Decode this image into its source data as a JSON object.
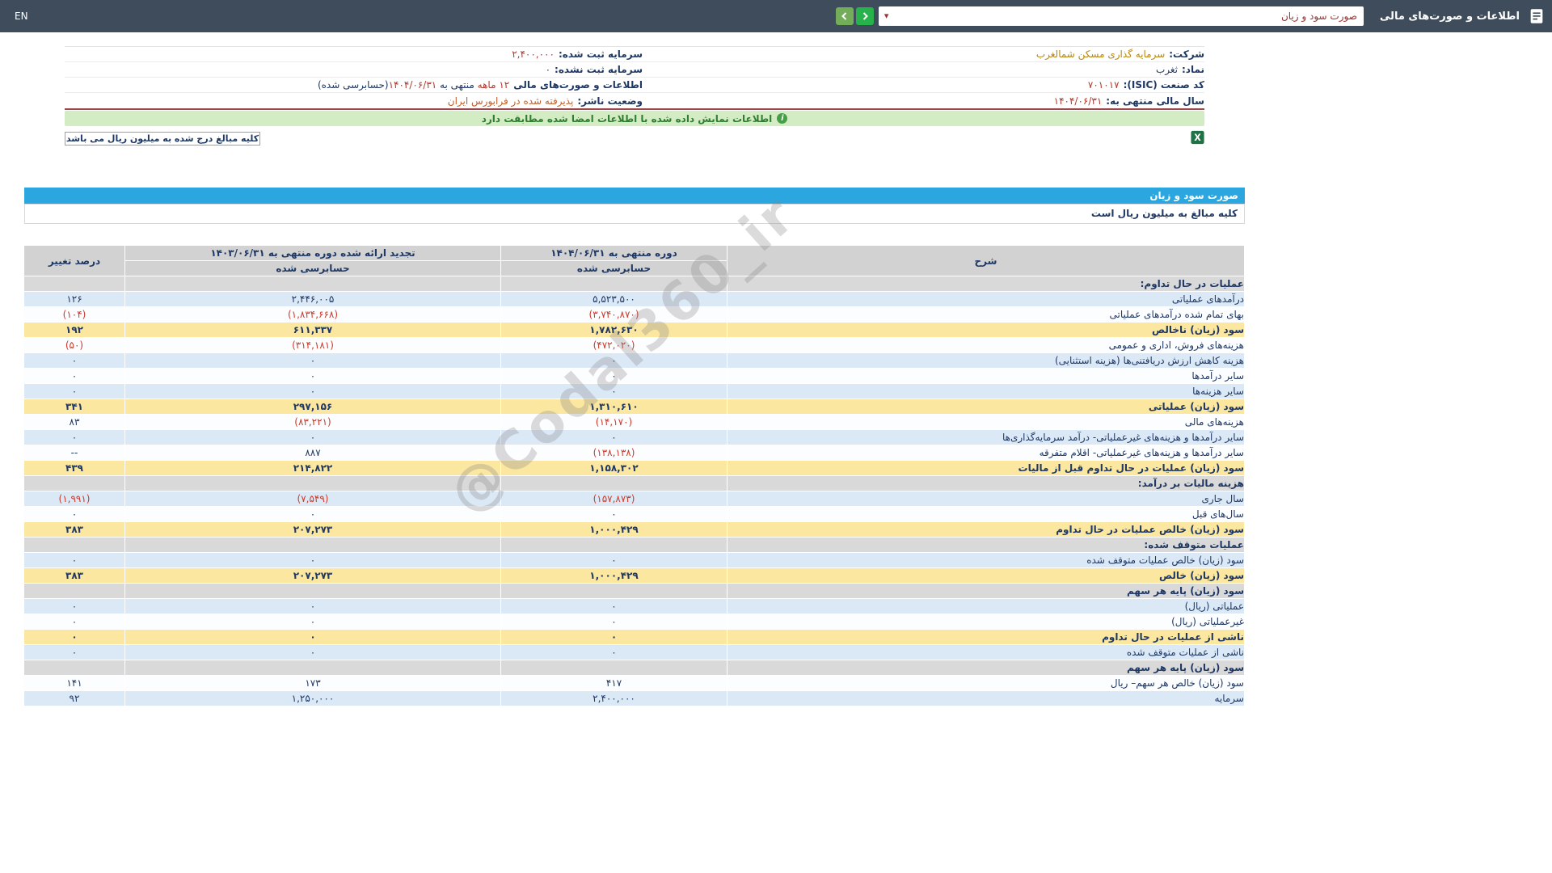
{
  "topbar": {
    "en_label": "EN",
    "title": "اطلاعات و صورت‌های مالی",
    "report_select_value": "صورت سود و زیان"
  },
  "banner": {
    "text": "اطلاعات نمایش داده شده با اطلاعات امضا شده مطابقت دارد",
    "icon": "i"
  },
  "note": {
    "text": "کلیه مبالغ درج شده به میلیون ریال می باشد"
  },
  "company_info": {
    "rows": [
      {
        "right": {
          "label": "شرکت:",
          "value": "سرمایه گذاری مسکن شمالغرب",
          "style": "company"
        },
        "left": {
          "label": "سرمایه ثبت شده:",
          "value": "۲,۴۰۰,۰۰۰",
          "style": "red"
        }
      },
      {
        "right": {
          "label": "نماد:",
          "value": "ثغرب",
          "style": "navy"
        },
        "left": {
          "label": "سرمایه ثبت نشده:",
          "value": "۰",
          "style": "navy"
        }
      },
      {
        "right": {
          "label": "کد صنعت (ISIC):",
          "value": "۷۰۱۰۱۷",
          "style": "red"
        },
        "left": {
          "label": "اطلاعات و صورت‌های مالی",
          "parts": [
            {
              "t": "۱۲ ماهه ",
              "s": "red"
            },
            {
              "t": "منتهی به ",
              "s": "navy"
            },
            {
              "t": "۱۴۰۴/۰۶/۳۱",
              "s": "red"
            },
            {
              "t": "(حسابرسی شده)",
              "s": "navy"
            }
          ]
        }
      },
      {
        "right": {
          "label": "سال مالی منتهی به:",
          "value": "۱۴۰۴/۰۶/۳۱",
          "style": "red"
        },
        "left": {
          "label": "وضعیت ناشر:",
          "value": "پذیرفته شده در فرابورس ایران",
          "style": "orange"
        }
      }
    ]
  },
  "statement": {
    "title": "صورت سود و زیان",
    "subtitle": "کلیه مبالغ به میلیون ریال است"
  },
  "watermark": {
    "text": "@Codal360_ir"
  },
  "table": {
    "header": {
      "desc": "شرح",
      "period_current": "دوره منتهی به ۱۴۰۴/۰۶/۳۱",
      "period_prior": "تجدید ارائه شده دوره منتهی به ۱۴۰۳/۰۶/۳۱",
      "audited": "حسابرسی شده",
      "change": "درصد تغییر"
    },
    "rows": [
      {
        "type": "section",
        "bg": "gray",
        "label": "عملیات در حال تداوم:",
        "v1": "",
        "v2": "",
        "pct": ""
      },
      {
        "type": "data",
        "bg": "blue",
        "label": "درآمدهای عملیاتی",
        "v1": "۵,۵۲۳,۵۰۰",
        "v2": "۲,۴۴۶,۰۰۵",
        "pct": "۱۲۶"
      },
      {
        "type": "data",
        "bg": "white",
        "label": "بهای تمام شده درآمدهای عملیاتی",
        "v1": "(۳,۷۴۰,۸۷۰)",
        "v2": "(۱,۸۳۴,۶۶۸)",
        "pct": "(۱۰۴)"
      },
      {
        "type": "total",
        "bg": "yellow",
        "label": "سود (زیان) ناخالص",
        "v1": "۱,۷۸۲,۶۳۰",
        "v2": "۶۱۱,۳۳۷",
        "pct": "۱۹۲"
      },
      {
        "type": "data",
        "bg": "white",
        "label": "هزینه‌های فروش، اداری و عمومی",
        "v1": "(۴۷۲,۰۲۰)",
        "v2": "(۳۱۴,۱۸۱)",
        "pct": "(۵۰)"
      },
      {
        "type": "data",
        "bg": "blue",
        "label": "هزینه کاهش ارزش دریافتنی‌ها (هزینه استثنایی)",
        "v1": "۰",
        "v2": "۰",
        "pct": "۰"
      },
      {
        "type": "data",
        "bg": "white",
        "label": "سایر درآمدها",
        "v1": "۰",
        "v2": "۰",
        "pct": "۰"
      },
      {
        "type": "data",
        "bg": "blue",
        "label": "سایر هزینه‌ها",
        "v1": "۰",
        "v2": "۰",
        "pct": "۰"
      },
      {
        "type": "total",
        "bg": "yellow",
        "label": "سود (زیان) عملیاتی",
        "v1": "۱,۳۱۰,۶۱۰",
        "v2": "۲۹۷,۱۵۶",
        "pct": "۳۴۱"
      },
      {
        "type": "data",
        "bg": "white",
        "label": "هزینه‌های مالی",
        "v1": "(۱۴,۱۷۰)",
        "v2": "(۸۳,۲۲۱)",
        "pct": "۸۳"
      },
      {
        "type": "data",
        "bg": "blue",
        "label": "سایر درآمدها و هزینه‌های غیرعملیاتی- درآمد سرمایه‌گذاری‌ها",
        "v1": "۰",
        "v2": "۰",
        "pct": "۰"
      },
      {
        "type": "data",
        "bg": "white",
        "label": "سایر درآمدها و هزینه‌های غیرعملیاتی- اقلام متفرقه",
        "v1": "(۱۳۸,۱۳۸)",
        "v2": "۸۸۷",
        "pct": "--"
      },
      {
        "type": "total",
        "bg": "yellow",
        "label": "سود (زیان) عملیات در حال تداوم قبل از مالیات",
        "v1": "۱,۱۵۸,۳۰۲",
        "v2": "۲۱۴,۸۲۲",
        "pct": "۴۳۹"
      },
      {
        "type": "section",
        "bg": "gray",
        "label": "هزینه مالیات بر درآمد:",
        "v1": "",
        "v2": "",
        "pct": ""
      },
      {
        "type": "data",
        "bg": "blue",
        "label": "سال جاری",
        "v1": "(۱۵۷,۸۷۳)",
        "v2": "(۷,۵۴۹)",
        "pct": "(۱,۹۹۱)"
      },
      {
        "type": "data",
        "bg": "white",
        "label": "سال‌های قبل",
        "v1": "۰",
        "v2": "۰",
        "pct": "۰"
      },
      {
        "type": "total",
        "bg": "yellow",
        "label": "سود (زیان) خالص عملیات در حال تداوم",
        "v1": "۱,۰۰۰,۴۲۹",
        "v2": "۲۰۷,۲۷۳",
        "pct": "۳۸۳"
      },
      {
        "type": "section",
        "bg": "gray",
        "label": "عملیات متوقف شده:",
        "v1": "",
        "v2": "",
        "pct": ""
      },
      {
        "type": "data",
        "bg": "blue",
        "label": "سود (زیان) خالص عملیات متوقف شده",
        "v1": "۰",
        "v2": "۰",
        "pct": "۰"
      },
      {
        "type": "total",
        "bg": "yellow",
        "label": "سود (زیان) خالص",
        "v1": "۱,۰۰۰,۴۲۹",
        "v2": "۲۰۷,۲۷۳",
        "pct": "۳۸۳"
      },
      {
        "type": "section",
        "bg": "gray",
        "label": "سود (زیان) پایه هر سهم",
        "v1": "",
        "v2": "",
        "pct": ""
      },
      {
        "type": "data",
        "bg": "blue",
        "label": "عملیاتی (ریال)",
        "v1": "۰",
        "v2": "۰",
        "pct": "۰"
      },
      {
        "type": "data",
        "bg": "white",
        "label": "غیرعملیاتی (ریال)",
        "v1": "۰",
        "v2": "۰",
        "pct": "۰"
      },
      {
        "type": "total",
        "bg": "yellow",
        "label": "ناشی از عملیات در حال تداوم",
        "v1": "۰",
        "v2": "۰",
        "pct": "۰"
      },
      {
        "type": "data",
        "bg": "blue",
        "label": "ناشی از عملیات متوقف شده",
        "v1": "۰",
        "v2": "۰",
        "pct": "۰"
      },
      {
        "type": "section",
        "bg": "gray",
        "label": "سود (زیان) پایه هر سهم",
        "v1": "",
        "v2": "",
        "pct": ""
      },
      {
        "type": "data",
        "bg": "white",
        "label": "سود (زیان) خالص هر سهم– ریال",
        "v1": "۴۱۷",
        "v2": "۱۷۳",
        "pct": "۱۴۱"
      },
      {
        "type": "data",
        "bg": "blue",
        "label": "سرمایه",
        "v1": "۲,۴۰۰,۰۰۰",
        "v2": "۱,۲۵۰,۰۰۰",
        "pct": "۹۲"
      }
    ]
  },
  "colors": {
    "topbar": "#3e4c5b",
    "accent_blue": "#2ba6df",
    "highlight_yellow": "#fbe79f",
    "stripe_blue": "#dbe9f6",
    "section_gray": "#d9d9d9",
    "negative_red": "#cc3a2a",
    "positive_navy": "#1f3864",
    "banner_green": "#d3ecc3"
  }
}
